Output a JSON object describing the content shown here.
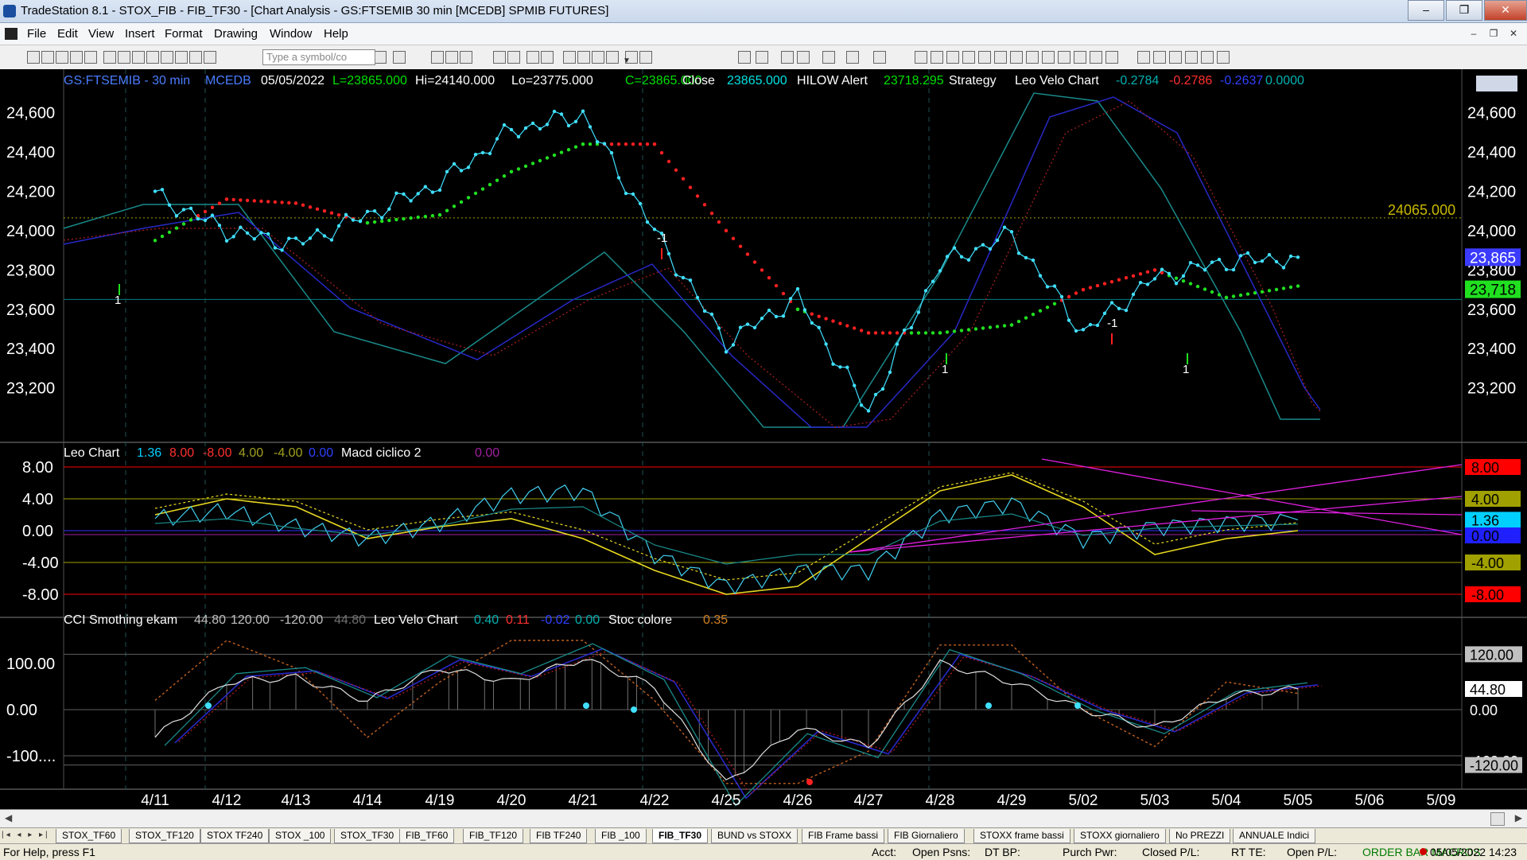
{
  "window": {
    "title": "TradeStation 8.1 - STOX_FIB - FIB_TF30 - [Chart Analysis - GS:FTSEMIB  30 min  [MCEDB] SPMIB FUTURES]",
    "min": "‒",
    "max": "❐",
    "close": "✕"
  },
  "menu": [
    "File",
    "Edit",
    "View",
    "Insert",
    "Format",
    "Drawing",
    "Window",
    "Help"
  ],
  "mdi": [
    "‒",
    "❐",
    "✕"
  ],
  "toolbar": {
    "symbol_placeholder": "Type a symbol/co"
  },
  "price_pane": {
    "header": [
      {
        "text": "GS:FTSEMIB - 30 min",
        "color": "#4a7cff"
      },
      {
        "text": "MCEDB",
        "color": "#4a7cff"
      },
      {
        "text": "05/05/2022",
        "color": "#ffffff"
      },
      {
        "text": "L=23865.000",
        "color": "#00e000"
      },
      {
        "text": "Hi=24140.000",
        "color": "#ffffff"
      },
      {
        "text": "Lo=23775.000",
        "color": "#ffffff"
      },
      {
        "text": "C=23865.000",
        "color": "#00e000"
      },
      {
        "text": "Close",
        "color": "#ffffff"
      },
      {
        "text": "23865.000",
        "color": "#00e0e0"
      },
      {
        "text": "HILOW Alert",
        "color": "#ffffff"
      },
      {
        "text": "23718.295",
        "color": "#00e000"
      },
      {
        "text": "Strategy",
        "color": "#ffffff"
      },
      {
        "text": "Leo Velo Chart",
        "color": "#ffffff"
      },
      {
        "text": "-0.2784",
        "color": "#00b0b0"
      },
      {
        "text": "-0.2786",
        "color": "#ff3030"
      },
      {
        "text": "-0.2637",
        "color": "#3040ff"
      },
      {
        "text": "0.0000",
        "color": "#00b0b0"
      }
    ],
    "y_ticks": [
      "24,600",
      "24,400",
      "24,200",
      "24,000",
      "23,800",
      "23,600",
      "23,400",
      "23,200"
    ],
    "y_ticks_right": [
      "24,600",
      "24,400",
      "24,200",
      "24,000",
      "23,800",
      "23,600",
      "23,400",
      "23,200"
    ],
    "ref_label": "24065.000",
    "price_badge": "23,865",
    "alert_badge": "23,718",
    "signals": [
      {
        "text": "-1",
        "color": "#ffffff"
      },
      {
        "text": "1",
        "color": "#ffffff"
      },
      {
        "text": "-1",
        "color": "#ffffff"
      },
      {
        "text": "1",
        "color": "#ffffff"
      },
      {
        "text": "1",
        "color": "#ffffff"
      }
    ]
  },
  "osc_pane": {
    "header": [
      {
        "text": "Leo Chart",
        "color": "#ffffff"
      },
      {
        "text": "1.36",
        "color": "#00d0ff"
      },
      {
        "text": "8.00",
        "color": "#ff3030"
      },
      {
        "text": "-8.00",
        "color": "#ff3030"
      },
      {
        "text": "4.00",
        "color": "#a0a020"
      },
      {
        "text": "-4.00",
        "color": "#a0a020"
      },
      {
        "text": "0.00",
        "color": "#3040ff"
      },
      {
        "text": "Macd ciclico 2",
        "color": "#ffffff"
      },
      {
        "text": "0.00",
        "color": "#a020a0"
      }
    ],
    "y_ticks": [
      "8.00",
      "4.00",
      "0.00",
      "-4.00",
      "-8.00"
    ],
    "right_badges": [
      {
        "text": "8.00",
        "bg": "#ff0000",
        "fg": "#000000"
      },
      {
        "text": "4.00",
        "bg": "#a0a000",
        "fg": "#000000"
      },
      {
        "text": "1.36",
        "bg": "#00d0ff",
        "fg": "#000000"
      },
      {
        "text": "0.00",
        "bg": "#2020ff",
        "fg": "#000000"
      },
      {
        "text": "-4.00",
        "bg": "#a0a000",
        "fg": "#000000"
      },
      {
        "text": "-8.00",
        "bg": "#ff0000",
        "fg": "#000000"
      }
    ]
  },
  "cci_pane": {
    "header": [
      {
        "text": "CCI Smothing ekam",
        "color": "#ffffff"
      },
      {
        "text": "44.80",
        "color": "#c0c0c0"
      },
      {
        "text": "120.00",
        "color": "#c0c0c0"
      },
      {
        "text": "-120.00",
        "color": "#c0c0c0"
      },
      {
        "text": "44.80",
        "color": "#707070"
      },
      {
        "text": "Leo Velo Chart",
        "color": "#ffffff"
      },
      {
        "text": "0.40",
        "color": "#00b0b0"
      },
      {
        "text": "0.11",
        "color": "#ff3030"
      },
      {
        "text": "-0.02",
        "color": "#3040ff"
      },
      {
        "text": "0.00",
        "color": "#00b0b0"
      },
      {
        "text": "Stoc colore",
        "color": "#ffffff"
      },
      {
        "text": "0.35",
        "color": "#d08020"
      }
    ],
    "y_ticks": [
      "100.00",
      "0.00",
      "-100...."
    ],
    "right_badges": [
      {
        "text": "120.00",
        "bg": "#c0c0c0",
        "fg": "#000000"
      },
      {
        "text": "44.80",
        "bg": "#ffffff",
        "fg": "#000000"
      },
      {
        "text": "0.00",
        "bg": "#000000",
        "fg": "#ffffff"
      },
      {
        "text": "-100.00",
        "bg": "#000000",
        "fg": "#ffffff"
      },
      {
        "text": "-120.00",
        "bg": "#c0c0c0",
        "fg": "#000000"
      }
    ]
  },
  "x_ticks": [
    "4/11",
    "4/12",
    "4/13",
    "4/14",
    "4/19",
    "4/20",
    "4/21",
    "4/22",
    "4/25",
    "4/26",
    "4/27",
    "4/28",
    "4/29",
    "5/02",
    "5/03",
    "5/04",
    "5/05",
    "5/06",
    "5/09"
  ],
  "tabs": [
    "STOX_TF60",
    "STOX_TF120",
    "STOX TF240",
    "STOX _100",
    "STOX_TF30",
    "FIB_TF60",
    "FIB_TF120",
    "FIB TF240",
    "FIB _100",
    "FIB_TF30",
    "BUND vs STOXX",
    "FIB Frame bassi",
    "FIB Giornaliero",
    "STOXX frame bassi",
    "STOXX giornaliero",
    "No PREZZI",
    "ANNUALE Indici"
  ],
  "active_tab": "FIB_TF30",
  "status": {
    "help": "For Help, press F1",
    "acct": "Acct:",
    "open_psns": "Open Psns:",
    "dt_bp": "DT BP:",
    "purch_pwr": "Purch Pwr:",
    "closed_pl": "Closed P/L:",
    "rt_te": "RT TE:",
    "open_pl": "Open P/L:",
    "macros": "ORDER BAR  MACROS",
    "datetime": "05/05/2022 14:23"
  },
  "colors": {
    "price": "#40e0ff",
    "hilow_red": "#ff2020",
    "hilow_green": "#20e020",
    "osc_yellow": "#e8d820",
    "magenta": "#e020e0"
  },
  "chart_data": [
    {
      "type": "line",
      "title": "GS:FTSEMIB - 30 min",
      "xlabel": "",
      "ylabel": "",
      "x": [
        "4/11",
        "4/12",
        "4/13",
        "4/14",
        "4/19",
        "4/20",
        "4/21",
        "4/22",
        "4/25",
        "4/26",
        "4/27",
        "4/28",
        "4/29",
        "5/02",
        "5/03",
        "5/04",
        "5/05"
      ],
      "ylim": [
        23000,
        24700
      ],
      "grid": false,
      "series": [
        {
          "name": "Close",
          "values": [
            24180,
            24000,
            23930,
            24080,
            24240,
            24510,
            24590,
            24000,
            23430,
            23660,
            23080,
            23830,
            23980,
            23480,
            23760,
            23840,
            23865
          ]
        },
        {
          "name": "HILOW Alert",
          "values": [
            23950,
            24160,
            24140,
            24040,
            24080,
            24300,
            24440,
            24440,
            24000,
            23600,
            23480,
            23480,
            23520,
            23700,
            23800,
            23660,
            23718
          ]
        }
      ],
      "reference_lines": [
        {
          "label": "24065.000",
          "value": 24065
        },
        {
          "value": 23650
        }
      ]
    },
    {
      "type": "line",
      "title": "Leo Chart",
      "ylim": [
        -10,
        10
      ],
      "x": [
        "4/11",
        "4/12",
        "4/13",
        "4/14",
        "4/19",
        "4/20",
        "4/21",
        "4/22",
        "4/25",
        "4/26",
        "4/27",
        "4/28",
        "4/29",
        "5/02",
        "5/03",
        "5/04",
        "5/05"
      ],
      "series": [
        {
          "name": "Leo Chart",
          "values": [
            1.5,
            2.5,
            0.5,
            -1.0,
            1.0,
            4.5,
            5.0,
            -3.0,
            -7.0,
            -5.0,
            -5.0,
            2.0,
            3.5,
            -1.0,
            0.5,
            1.0,
            1.36
          ]
        },
        {
          "name": "Macd ciclico 2",
          "values": [
            2.0,
            4.0,
            3.0,
            -1.0,
            0.5,
            1.5,
            -1.0,
            -5.0,
            -8.0,
            -7.0,
            -1.0,
            5.0,
            7.0,
            3.0,
            -3.0,
            -1.0,
            0.0
          ]
        }
      ],
      "levels": [
        8,
        4,
        0,
        -4,
        -8
      ]
    },
    {
      "type": "line",
      "title": "CCI Smothing ekam",
      "ylim": [
        -160,
        170
      ],
      "x": [
        "4/11",
        "4/12",
        "4/13",
        "4/14",
        "4/19",
        "4/20",
        "4/21",
        "4/22",
        "4/25",
        "4/26",
        "4/27",
        "4/28",
        "4/29",
        "5/02",
        "5/03",
        "5/04",
        "5/05"
      ],
      "series": [
        {
          "name": "CCI Smothing ekam",
          "values": [
            -60,
            60,
            70,
            20,
            90,
            60,
            110,
            50,
            -160,
            -40,
            -80,
            100,
            60,
            0,
            -40,
            30,
            44.8
          ]
        },
        {
          "name": "Stoc colore",
          "values": [
            20,
            150,
            90,
            -60,
            60,
            150,
            150,
            20,
            -160,
            -160,
            -90,
            140,
            140,
            0,
            -80,
            60,
            35
          ]
        }
      ],
      "levels": [
        120,
        0,
        -120
      ]
    }
  ]
}
